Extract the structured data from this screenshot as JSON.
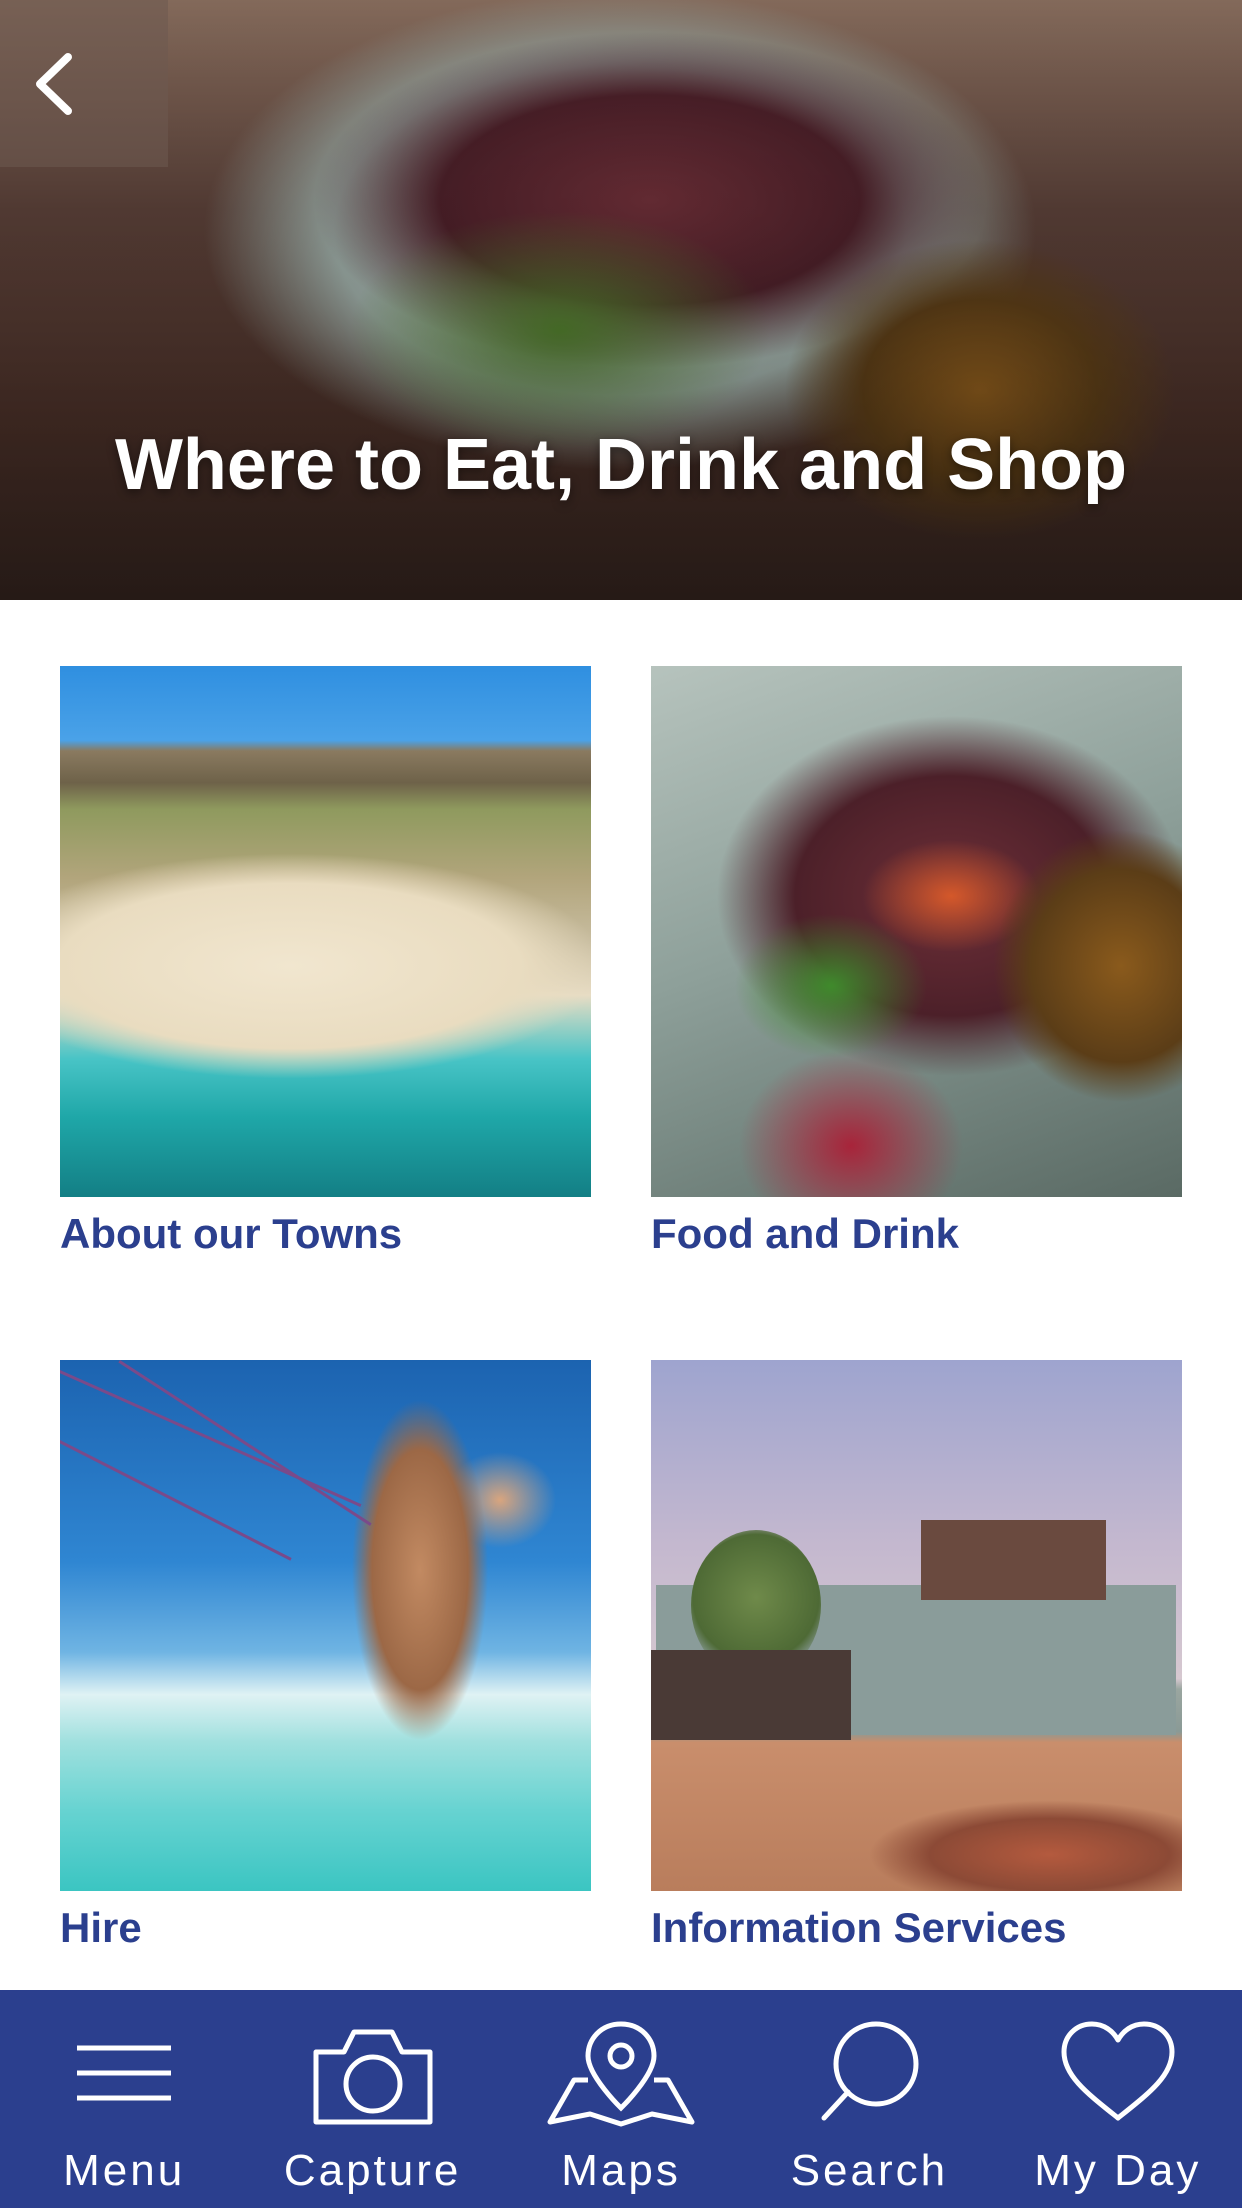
{
  "hero": {
    "title": "Where to Eat, Drink and Shop"
  },
  "icons": {
    "back": "chevron-left-icon",
    "menu": "hamburger-icon",
    "capture": "camera-icon",
    "maps": "map-pin-icon",
    "search": "search-icon",
    "my_day": "heart-icon"
  },
  "tiles": [
    {
      "label": "About our Towns"
    },
    {
      "label": "Food and Drink"
    },
    {
      "label": "Hire"
    },
    {
      "label": "Information Services"
    }
  ],
  "bottom_nav": {
    "items": [
      {
        "label": "Menu"
      },
      {
        "label": "Capture"
      },
      {
        "label": "Maps"
      },
      {
        "label": "Search"
      },
      {
        "label": "My Day"
      }
    ]
  },
  "colors": {
    "brand_blue": "#2b3f8e",
    "label_blue": "#2b3f8e",
    "white": "#ffffff"
  }
}
